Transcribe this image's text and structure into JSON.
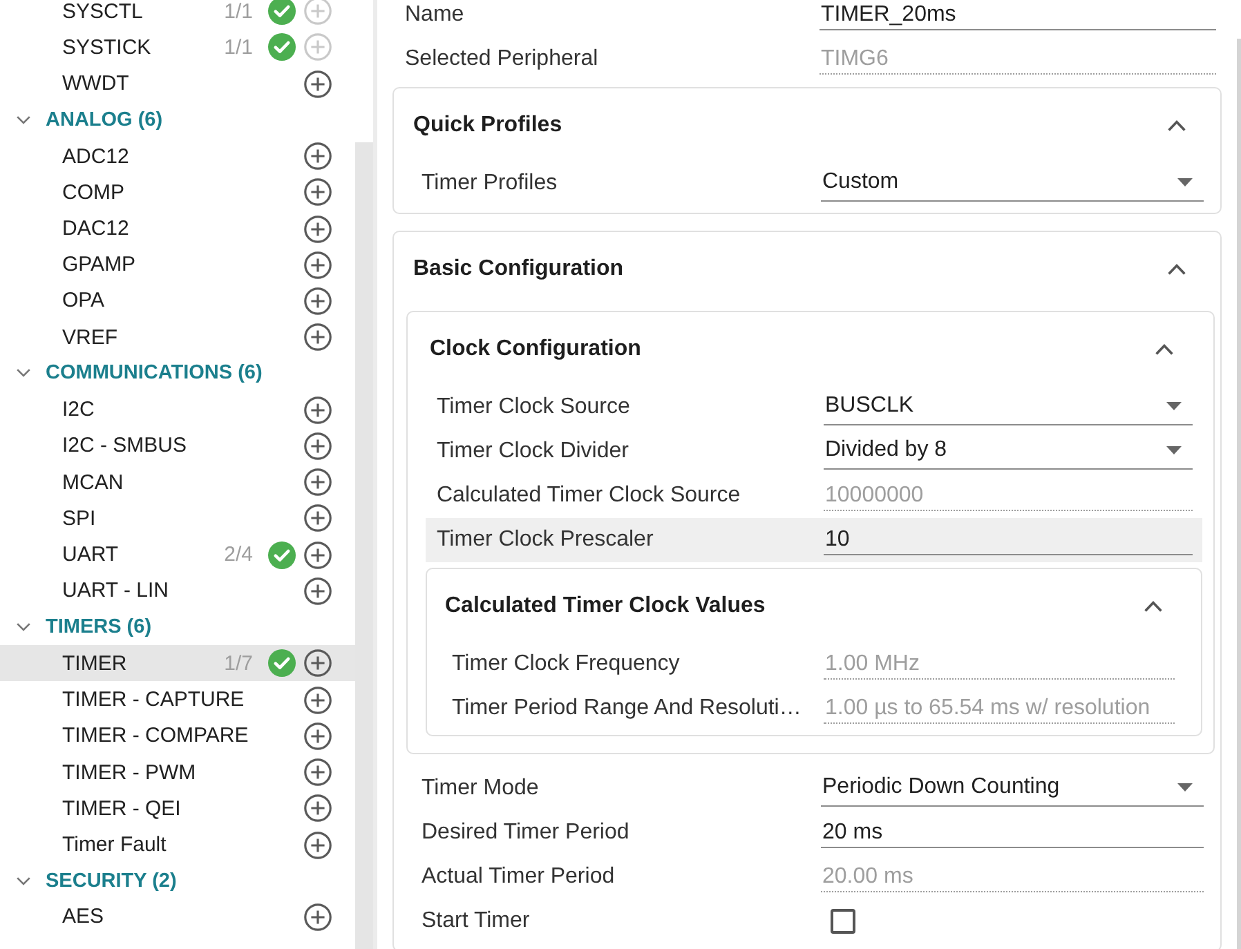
{
  "sidebar": {
    "sections": [
      {
        "items": [
          {
            "label": "SYSCTL",
            "count": "1/1",
            "configured": true,
            "add_disabled": true,
            "selected": false
          },
          {
            "label": "SYSTICK",
            "count": "1/1",
            "configured": true,
            "add_disabled": true,
            "selected": false
          },
          {
            "label": "WWDT",
            "configured": false,
            "add_disabled": false,
            "selected": false
          }
        ]
      },
      {
        "label": "ANALOG (6)",
        "expanded": true,
        "items": [
          {
            "label": "ADC12",
            "configured": false,
            "add_disabled": false,
            "selected": false
          },
          {
            "label": "COMP",
            "configured": false,
            "add_disabled": false,
            "selected": false
          },
          {
            "label": "DAC12",
            "configured": false,
            "add_disabled": false,
            "selected": false
          },
          {
            "label": "GPAMP",
            "configured": false,
            "add_disabled": false,
            "selected": false
          },
          {
            "label": "OPA",
            "configured": false,
            "add_disabled": false,
            "selected": false
          },
          {
            "label": "VREF",
            "configured": false,
            "add_disabled": false,
            "selected": false
          }
        ]
      },
      {
        "label": "COMMUNICATIONS (6)",
        "expanded": true,
        "items": [
          {
            "label": "I2C",
            "configured": false,
            "add_disabled": false,
            "selected": false
          },
          {
            "label": "I2C - SMBUS",
            "configured": false,
            "add_disabled": false,
            "selected": false
          },
          {
            "label": "MCAN",
            "configured": false,
            "add_disabled": false,
            "selected": false
          },
          {
            "label": "SPI",
            "configured": false,
            "add_disabled": false,
            "selected": false
          },
          {
            "label": "UART",
            "count": "2/4",
            "configured": true,
            "add_disabled": false,
            "selected": false
          },
          {
            "label": "UART - LIN",
            "configured": false,
            "add_disabled": false,
            "selected": false
          }
        ]
      },
      {
        "label": "TIMERS (6)",
        "expanded": true,
        "items": [
          {
            "label": "TIMER",
            "count": "1/7",
            "configured": true,
            "add_disabled": false,
            "selected": true
          },
          {
            "label": "TIMER - CAPTURE",
            "configured": false,
            "add_disabled": false,
            "selected": false
          },
          {
            "label": "TIMER - COMPARE",
            "configured": false,
            "add_disabled": false,
            "selected": false
          },
          {
            "label": "TIMER - PWM",
            "configured": false,
            "add_disabled": false,
            "selected": false
          },
          {
            "label": "TIMER - QEI",
            "configured": false,
            "add_disabled": false,
            "selected": false
          },
          {
            "label": "Timer Fault",
            "configured": false,
            "add_disabled": false,
            "selected": false
          }
        ]
      },
      {
        "label": "SECURITY (2)",
        "expanded": true,
        "items": [
          {
            "label": "AES",
            "configured": false,
            "add_disabled": false,
            "selected": false
          }
        ]
      }
    ]
  },
  "form": {
    "content": [
      {
        "kind": "text",
        "label": "Name",
        "value": "TIMER_20ms",
        "highlighted": false
      },
      {
        "kind": "readonly",
        "label": "Selected Peripheral",
        "value": "TIMG6",
        "highlighted": false
      },
      {
        "kind": "panel",
        "title": "Quick Profiles",
        "expanded": true,
        "content": [
          {
            "kind": "select",
            "label": "Timer Profiles",
            "value": "Custom",
            "highlighted": false
          }
        ]
      },
      {
        "kind": "panel",
        "title": "Basic Configuration",
        "expanded": true,
        "content": [
          {
            "kind": "panel",
            "title": "Clock Configuration",
            "expanded": true,
            "content": [
              {
                "kind": "select",
                "label": "Timer Clock Source",
                "value": "BUSCLK",
                "highlighted": false
              },
              {
                "kind": "select",
                "label": "Timer Clock Divider",
                "value": "Divided by 8",
                "highlighted": false
              },
              {
                "kind": "readonly",
                "label": "Calculated Timer Clock Source",
                "value": "10000000",
                "highlighted": false
              },
              {
                "kind": "text",
                "label": "Timer Clock Prescaler",
                "value": "10",
                "highlighted": true
              },
              {
                "kind": "panel",
                "title": "Calculated Timer Clock Values",
                "expanded": true,
                "content": [
                  {
                    "kind": "readonly",
                    "label": "Timer Clock Frequency",
                    "value": "1.00 MHz",
                    "highlighted": false
                  },
                  {
                    "kind": "readonly",
                    "label": "Timer Period Range And Resoluti…",
                    "value": "1.00 µs to 65.54 ms w/ resolution",
                    "highlighted": false
                  }
                ]
              }
            ]
          },
          {
            "kind": "select",
            "label": "Timer Mode",
            "value": "Periodic Down Counting",
            "highlighted": false
          },
          {
            "kind": "text",
            "label": "Desired Timer Period",
            "value": "20 ms",
            "highlighted": false
          },
          {
            "kind": "readonly",
            "label": "Actual Timer Period",
            "value": "20.00 ms",
            "highlighted": false
          },
          {
            "kind": "checkbox",
            "label": "Start Timer",
            "checked": false,
            "highlighted": false
          }
        ]
      }
    ]
  }
}
